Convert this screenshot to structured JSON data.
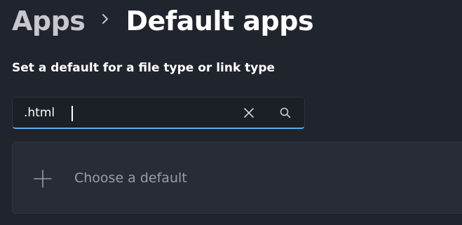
{
  "breadcrumb": {
    "parent": "Apps",
    "separator_icon": "chevron-right-icon",
    "current": "Default apps"
  },
  "section": {
    "heading": "Set a default for a file type or link type"
  },
  "search": {
    "value": ".html",
    "clear_icon": "close-icon",
    "search_icon": "search-icon",
    "accent_color": "#5aaee8"
  },
  "result_card": {
    "icon": "plus-icon",
    "label": "Choose a default"
  }
}
